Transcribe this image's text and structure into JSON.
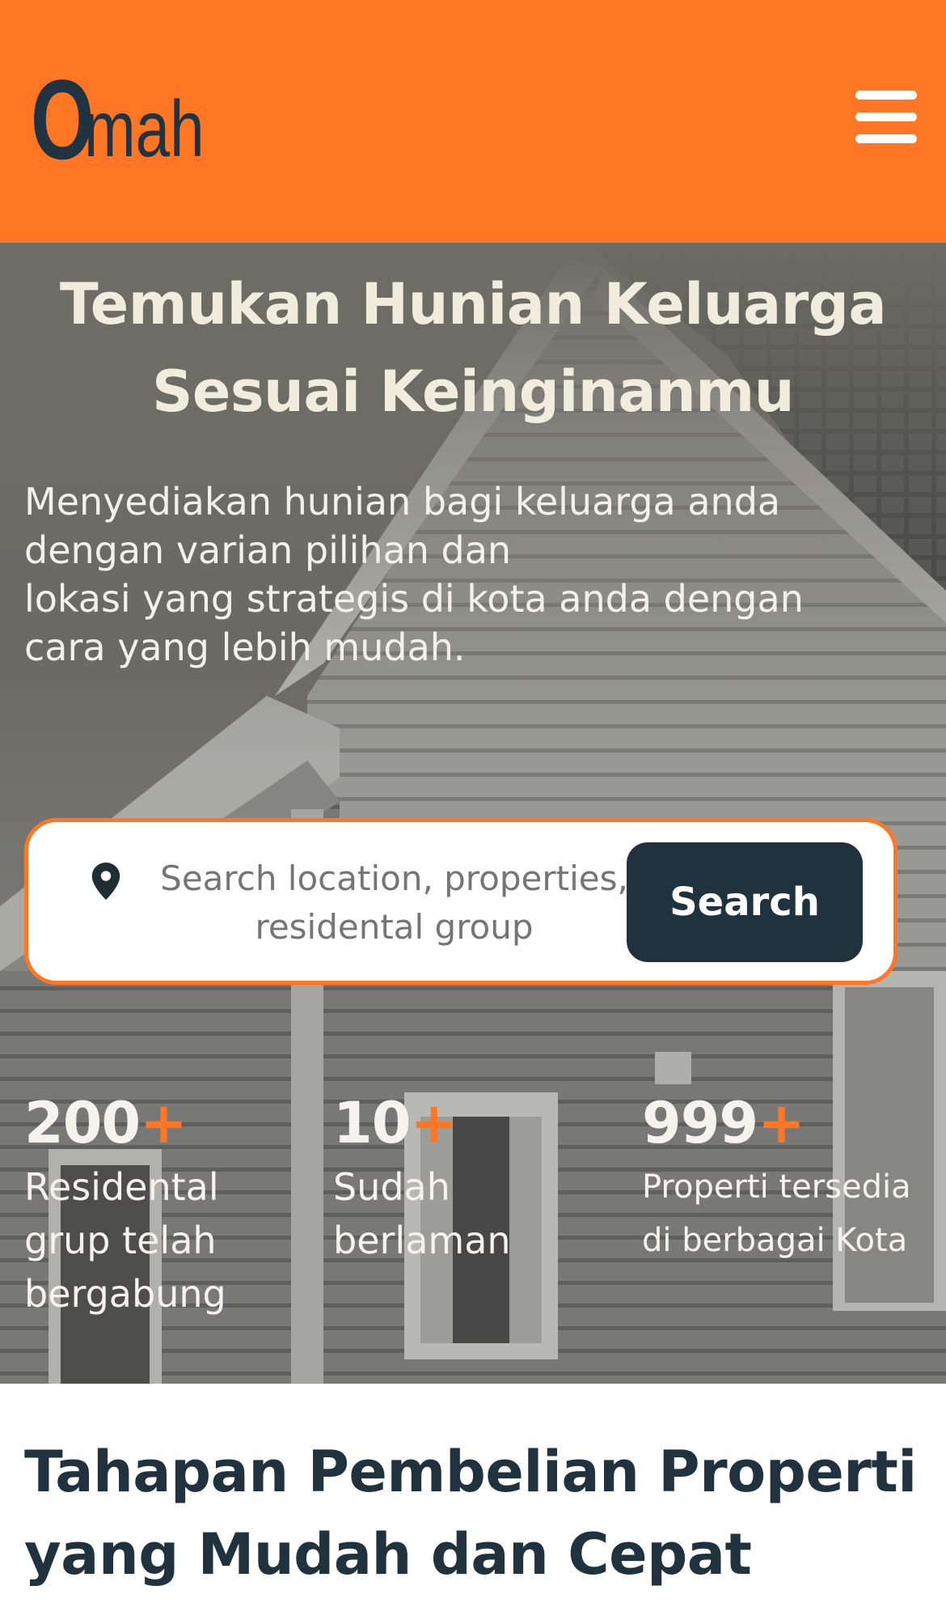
{
  "header": {
    "logo_first": "O",
    "logo_rest": "mah",
    "menu_icon": "hamburger-menu-icon"
  },
  "hero": {
    "title_line1": "Temukan Hunian Keluarga",
    "title_line2": "Sesuai Keinginanmu",
    "description_lines": [
      "Menyediakan hunian bagi keluarga anda",
      "dengan varian pilihan dan",
      "lokasi yang strategis di kota anda dengan",
      "cara yang lebih mudah."
    ]
  },
  "search": {
    "icon": "location-pin-icon",
    "placeholder": "Search location, properties, residental group",
    "button_label": "Search"
  },
  "stats": [
    {
      "number": "200",
      "suffix": "+",
      "label_lines": [
        "Residental",
        "grup telah",
        "bergabung"
      ]
    },
    {
      "number": "10",
      "suffix": "+",
      "label_lines": [
        "Sudah",
        "berlaman"
      ]
    },
    {
      "number": "999",
      "suffix": "+",
      "label_lines": [
        "Properti tersedia",
        "di berbagai Kota"
      ]
    }
  ],
  "section": {
    "title_line1": "Tahapan Pembelian Properti",
    "title_line2": "yang Mudah dan Cepat"
  },
  "colors": {
    "accent": "#ff7625",
    "dark": "#1f323e",
    "hero_text": "#f1ecdd"
  }
}
